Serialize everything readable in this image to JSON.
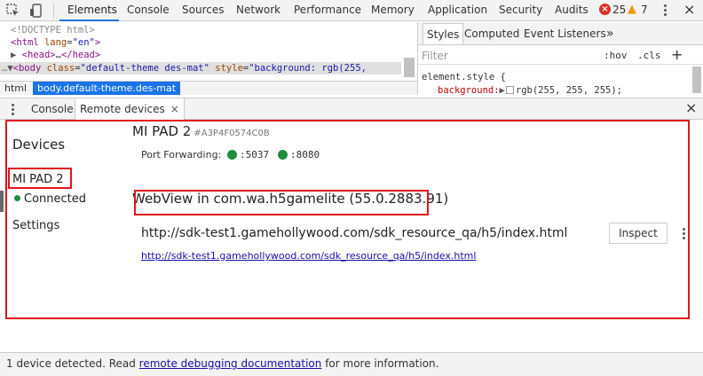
{
  "tabs": [
    {
      "label": "Elements",
      "active": true
    },
    {
      "label": "Console"
    },
    {
      "label": "Sources"
    },
    {
      "label": "Network"
    },
    {
      "label": "Performance"
    },
    {
      "label": "Memory"
    },
    {
      "label": "Application"
    },
    {
      "label": "Security"
    },
    {
      "label": "Audits"
    }
  ],
  "issues": {
    "errors": "25",
    "warnings": "7"
  },
  "elements": {
    "doctype": "<!DOCTYPE html>",
    "html_tag": "html",
    "html_attr": "lang",
    "html_val": "\"en\"",
    "head_tag": "head",
    "head_ellipsis": "…",
    "body_tag": "body",
    "body_class_attr": "class",
    "body_class_val": "\"default-theme des-mat\"",
    "body_style_attr": "style",
    "body_style_val": "\"background: rgb(255,"
  },
  "breadcrumbs": [
    "html",
    "body.default-theme.des-mat"
  ],
  "styles_panel": {
    "tabs": [
      "Styles",
      "Computed",
      "Event Listeners"
    ],
    "more": "»",
    "filter_placeholder": "Filter",
    "hov": ":hov",
    "cls": ".cls",
    "plus": "+",
    "rule_selector": "element.style {",
    "prop_name": "background:",
    "prop_value": "rgb(255, 255, 255);"
  },
  "drawer": {
    "tabs": [
      "Console",
      "Remote devices"
    ],
    "active_tab": "Remote devices",
    "close_glyph": "×"
  },
  "sidebar": {
    "heading": "Devices",
    "device": "MI PAD 2",
    "device_status": "Connected",
    "settings": "Settings"
  },
  "device": {
    "name": "MI PAD 2",
    "serial": "#A3P4F0574C0B",
    "port_forwarding_label": "Port Forwarding:",
    "ports": [
      ":5037",
      ":8080"
    ],
    "webview": "WebView in com.wa.h5gamelite (55.0.2883.91)",
    "page_url": "http://sdk-test1.gamehollywood.com/sdk_resource_qa/h5/index.html",
    "page_link": "http://sdk-test1.gamehollywood.com/sdk_resource_qa/h5/index.html",
    "inspect_label": "Inspect"
  },
  "status": {
    "prefix": "1 device detected. Read ",
    "link": "remote debugging documentation",
    "suffix": " for more information."
  },
  "colors": {
    "accent": "#1a73e8",
    "connected": "#1e8e3e",
    "annotation": "#e0151b",
    "error": "#d93025",
    "warning": "#f29900"
  }
}
